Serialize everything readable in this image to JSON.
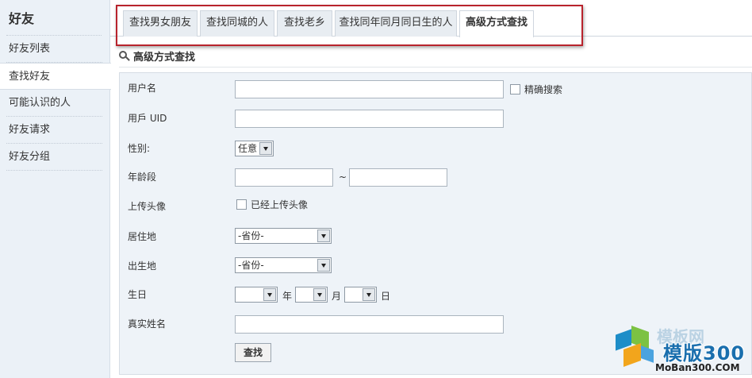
{
  "sidebar": {
    "title": "好友",
    "items": [
      {
        "label": "好友列表",
        "active": false
      },
      {
        "label": "查找好友",
        "active": true
      },
      {
        "label": "可能认识的人",
        "active": false
      },
      {
        "label": "好友请求",
        "active": false
      },
      {
        "label": "好友分组",
        "active": false
      }
    ]
  },
  "tabs": [
    {
      "label": "查找男女朋友",
      "active": false
    },
    {
      "label": "查找同城的人",
      "active": false
    },
    {
      "label": "查找老乡",
      "active": false
    },
    {
      "label": "查找同年同月同日生的人",
      "active": false
    },
    {
      "label": "高级方式查找",
      "active": true
    }
  ],
  "highlight_color": "#b8232c",
  "section": {
    "title": "高级方式查找",
    "icon": "magnifier-icon"
  },
  "form": {
    "username_label": "用户名",
    "username_value": "",
    "exact_search_label": "精确搜索",
    "exact_search_checked": false,
    "uid_label": "用戶 UID",
    "uid_value": "",
    "gender_label": "性别:",
    "gender_value": "任意",
    "age_label": "年龄段",
    "age_from": "",
    "age_separator": "~",
    "age_to": "",
    "avatar_label": "上传头像",
    "avatar_check_label": "已经上传头像",
    "avatar_checked": false,
    "residence_label": "居住地",
    "residence_value": "-省份-",
    "birthplace_label": "出生地",
    "birthplace_value": "-省份-",
    "birthday_label": "生日",
    "year_unit": "年",
    "month_unit": "月",
    "day_unit": "日",
    "birth_year": "",
    "birth_month": "",
    "birth_day": "",
    "realname_label": "真实姓名",
    "realname_value": "",
    "search_button": "查找"
  },
  "watermark": {
    "ghost_text": "模板网",
    "brand": "模版300",
    "url": "MoBan300.COM"
  }
}
